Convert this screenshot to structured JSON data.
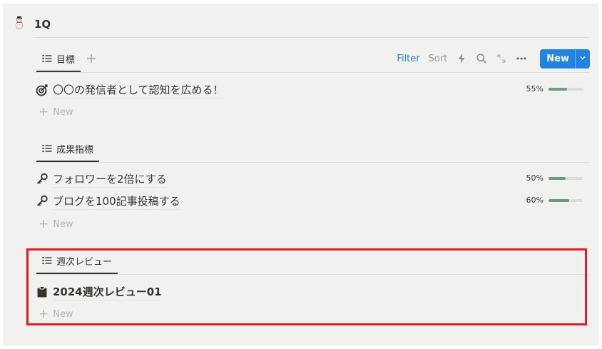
{
  "page": {
    "title": "1Q",
    "icon": "snowman-icon"
  },
  "toolbar": {
    "filter": "Filter",
    "sort": "Sort",
    "new_label": "New"
  },
  "sections": [
    {
      "tab_label": "目標",
      "items": [
        {
          "icon": "target-icon",
          "text": "〇〇の発信者として認知を広める！",
          "progress_text": "55%",
          "progress": 0.55
        }
      ],
      "new_label": "New"
    },
    {
      "tab_label": "成果指標",
      "items": [
        {
          "icon": "key-icon",
          "text": "フォロワーを2倍にする",
          "progress_text": "50%",
          "progress": 0.5
        },
        {
          "icon": "key-icon",
          "text": "ブログを100記事投稿する",
          "progress_text": "60%",
          "progress": 0.6
        }
      ],
      "new_label": "New"
    },
    {
      "tab_label": "週次レビュー",
      "items": [
        {
          "icon": "clipboard-icon",
          "text": "2024週次レビュー01"
        }
      ],
      "new_label": "New"
    }
  ],
  "colors": {
    "accent": "#2383e2",
    "progress": "#6c9b7d",
    "highlight": "#e01b24",
    "panel": "#f1f1ef"
  }
}
